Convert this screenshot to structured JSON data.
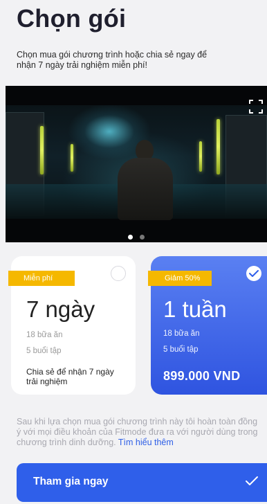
{
  "header": {
    "title": "Chọn gói",
    "subtitle": "Chọn mua gói chương trình hoặc chia sẻ ngay để nhận 7 ngày trải nghiệm miễn phí!"
  },
  "video": {
    "slide_count": 2,
    "active_slide": 1,
    "controls": [
      "fullscreen-icon"
    ]
  },
  "plans": [
    {
      "tag": "Miễn phí",
      "duration": "7 ngày",
      "meals": "18 bữa ăn",
      "workouts": "5 buổi tập",
      "footer": "Chia sẻ để nhận 7 ngày trải nghiệm",
      "selected": false
    },
    {
      "tag": "Giảm 50%",
      "duration": "1 tuần",
      "meals": "18 bữa ăn",
      "workouts": "5 buổi tập",
      "footer": "899.000 VND",
      "selected": true
    }
  ],
  "terms": {
    "text": "Sau khi lựa chọn mua gói chương trình này tôi hoàn toàn đồng ý với mọi điều khoản của Fitmode đưa ra với người dùng trong chương trình dinh dưỡng.",
    "link": "Tìm hiểu thêm"
  },
  "cta": {
    "label": "Tham gia ngay",
    "icon": "checkmark-icon"
  },
  "colors": {
    "accent": "#2f5fea",
    "tag": "#f5b800",
    "link": "#2e5fe6",
    "background": "#f2f2f4"
  }
}
